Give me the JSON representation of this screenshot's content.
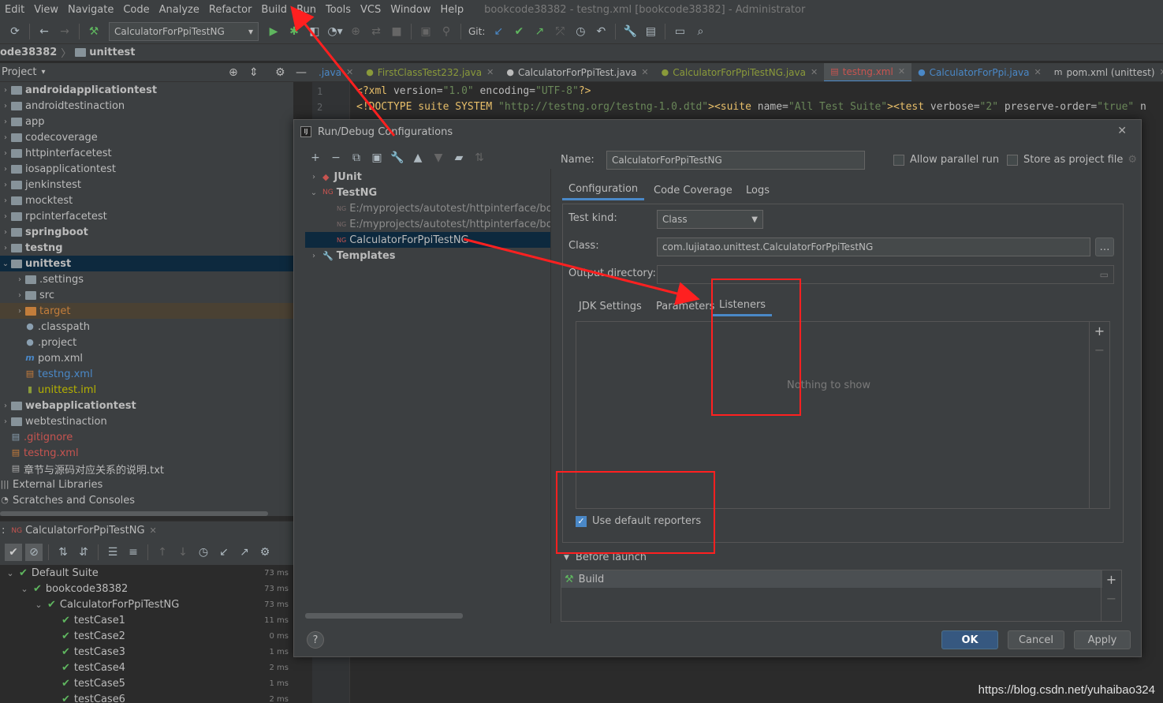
{
  "menu": [
    "Edit",
    "View",
    "Navigate",
    "Code",
    "Analyze",
    "Refactor",
    "Build",
    "Run",
    "Tools",
    "VCS",
    "Window",
    "Help"
  ],
  "window_title": "bookcode38382 - testng.xml [bookcode38382] - Administrator",
  "toolbar": {
    "run_config": "CalculatorForPpiTestNG",
    "git_label": "Git:"
  },
  "breadcrumb": {
    "project": "ode38382",
    "module": "unittest"
  },
  "project_panel": {
    "title": "Project",
    "tree": [
      {
        "label": "androidapplicationtest",
        "type": "folder",
        "bold": true,
        "depth": 0
      },
      {
        "label": "androidtestinaction",
        "type": "folder",
        "bold": false,
        "depth": 0
      },
      {
        "label": "app",
        "type": "folder",
        "bold": false,
        "depth": 0
      },
      {
        "label": "codecoverage",
        "type": "folder",
        "bold": false,
        "depth": 0
      },
      {
        "label": "httpinterfacetest",
        "type": "folder",
        "bold": false,
        "depth": 0
      },
      {
        "label": "iosapplicationtest",
        "type": "folder",
        "bold": false,
        "depth": 0
      },
      {
        "label": "jenkinstest",
        "type": "folder",
        "bold": false,
        "depth": 0
      },
      {
        "label": "mocktest",
        "type": "folder",
        "bold": false,
        "depth": 0
      },
      {
        "label": "rpcinterfacetest",
        "type": "folder",
        "bold": false,
        "depth": 0
      },
      {
        "label": "springboot",
        "type": "folder",
        "bold": true,
        "depth": 0
      },
      {
        "label": "testng",
        "type": "folder",
        "bold": true,
        "depth": 0
      },
      {
        "label": "unittest",
        "type": "folder",
        "bold": true,
        "depth": 0,
        "selected": true,
        "expanded": true
      },
      {
        "label": ".settings",
        "type": "folder",
        "bold": false,
        "depth": 1
      },
      {
        "label": "src",
        "type": "folder",
        "bold": false,
        "depth": 1
      },
      {
        "label": "target",
        "type": "folder-orange",
        "bold": false,
        "depth": 1,
        "excluded": true
      },
      {
        "label": ".classpath",
        "type": "file",
        "bold": false,
        "depth": 1
      },
      {
        "label": ".project",
        "type": "file",
        "bold": false,
        "depth": 1
      },
      {
        "label": "pom.xml",
        "type": "maven",
        "bold": false,
        "depth": 1
      },
      {
        "label": "testng.xml",
        "type": "xml",
        "bold": false,
        "depth": 1
      },
      {
        "label": "unittest.iml",
        "type": "iml",
        "bold": false,
        "depth": 1
      },
      {
        "label": "webapplicationtest",
        "type": "folder",
        "bold": true,
        "depth": 0
      },
      {
        "label": "webtestinaction",
        "type": "folder",
        "bold": false,
        "depth": 0
      },
      {
        "label": ".gitignore",
        "type": "ignored",
        "bold": false,
        "depth": 0
      },
      {
        "label": "testng.xml",
        "type": "xml-red",
        "bold": false,
        "depth": 0
      },
      {
        "label": "章节与源码对应关系的说明.txt",
        "type": "txt",
        "bold": false,
        "depth": 0
      },
      {
        "label": "External Libraries",
        "type": "lib",
        "bold": false,
        "depth": -1
      },
      {
        "label": "Scratches and Consoles",
        "type": "scratch",
        "bold": false,
        "depth": -1
      }
    ]
  },
  "run_panel": {
    "tab": "CalculatorForPpiTestNG",
    "tree": [
      {
        "label": "Default Suite",
        "time": "73 ms",
        "depth": 0
      },
      {
        "label": "bookcode38382",
        "time": "73 ms",
        "depth": 1
      },
      {
        "label": "CalculatorForPpiTestNG",
        "time": "73 ms",
        "depth": 2
      },
      {
        "label": "testCase1",
        "time": "11 ms",
        "depth": 3
      },
      {
        "label": "testCase2",
        "time": "0 ms",
        "depth": 3
      },
      {
        "label": "testCase3",
        "time": "1 ms",
        "depth": 3
      },
      {
        "label": "testCase4",
        "time": "2 ms",
        "depth": 3
      },
      {
        "label": "testCase5",
        "time": "1 ms",
        "depth": 3
      },
      {
        "label": "testCase6",
        "time": "2 ms",
        "depth": 3
      }
    ]
  },
  "editor": {
    "tabs": [
      {
        "label": ".java",
        "active": false,
        "color": "#4a88c7"
      },
      {
        "label": "FirstClassTest232.java",
        "active": false,
        "color": "#8a9a3a"
      },
      {
        "label": "CalculatorForPpiTest.java",
        "active": false,
        "color": "#bbbbbb"
      },
      {
        "label": "CalculatorForPpiTestNG.java",
        "active": false,
        "color": "#8a9a3a"
      },
      {
        "label": "testng.xml",
        "active": true,
        "color": "#c75450"
      },
      {
        "label": "CalculatorForPpi.java",
        "active": false,
        "color": "#4a88c7"
      },
      {
        "label": "pom.xml (unittest)",
        "active": false,
        "color": "#bbbbbb"
      }
    ],
    "lines": [
      {
        "n": "1",
        "parts": [
          [
            "tag",
            "<?xml "
          ],
          [
            "attr",
            "version="
          ],
          [
            "str",
            "\"1.0\""
          ],
          [
            "attr",
            " encoding="
          ],
          [
            "str",
            "\"UTF-8\""
          ],
          [
            "tag",
            "?>"
          ]
        ]
      },
      {
        "n": "2",
        "parts": [
          [
            "tag",
            "<!DOCTYPE suite SYSTEM "
          ],
          [
            "str",
            "\"http://testng.org/testng-1.0.dtd\""
          ],
          [
            "tag",
            "><suite "
          ],
          [
            "attr",
            "name="
          ],
          [
            "str",
            "\"All Test Suite\""
          ],
          [
            "tag",
            "><test "
          ],
          [
            "attr",
            "verbose="
          ],
          [
            "str",
            "\"2\""
          ],
          [
            "attr",
            " preserve-order="
          ],
          [
            "str",
            "\"true\""
          ],
          [
            "attr",
            " n"
          ]
        ]
      }
    ]
  },
  "dialog": {
    "title": "Run/Debug Configurations",
    "tree": [
      {
        "label": "JUnit",
        "kind": "group",
        "expanded": false
      },
      {
        "label": "TestNG",
        "kind": "group",
        "expanded": true
      },
      {
        "label": "E:/myprojects/autotest/httpinterface/bookcode",
        "kind": "item",
        "dim": true
      },
      {
        "label": "E:/myprojects/autotest/httpinterface/bookcode",
        "kind": "item",
        "dim": true
      },
      {
        "label": "CalculatorForPpiTestNG",
        "kind": "item",
        "selected": true
      },
      {
        "label": "Templates",
        "kind": "group",
        "expanded": false
      }
    ],
    "name_label": "Name:",
    "name_value": "CalculatorForPpiTestNG",
    "allow_parallel": "Allow parallel run",
    "store_as_project": "Store as project file",
    "tabs": [
      "Configuration",
      "Code Coverage",
      "Logs"
    ],
    "test_kind_label": "Test kind:",
    "test_kind_value": "Class",
    "class_label": "Class:",
    "class_value": "com.lujiatao.unittest.CalculatorForPpiTestNG",
    "output_dir_label": "Output directory:",
    "output_dir_value": "",
    "inner_tabs": [
      "JDK Settings",
      "Parameters",
      "Listeners"
    ],
    "listeners_empty": "Nothing to show",
    "use_default_reporters": "Use default reporters",
    "before_launch": "Before launch",
    "before_launch_item": "Build",
    "buttons": {
      "ok": "OK",
      "cancel": "Cancel",
      "apply": "Apply",
      "help": "?"
    }
  },
  "watermark": "https://blog.csdn.net/yuhaibao324",
  "colors": {
    "accent": "#4a88c7",
    "annotation": "#ff2020",
    "success": "#5fb65f"
  }
}
